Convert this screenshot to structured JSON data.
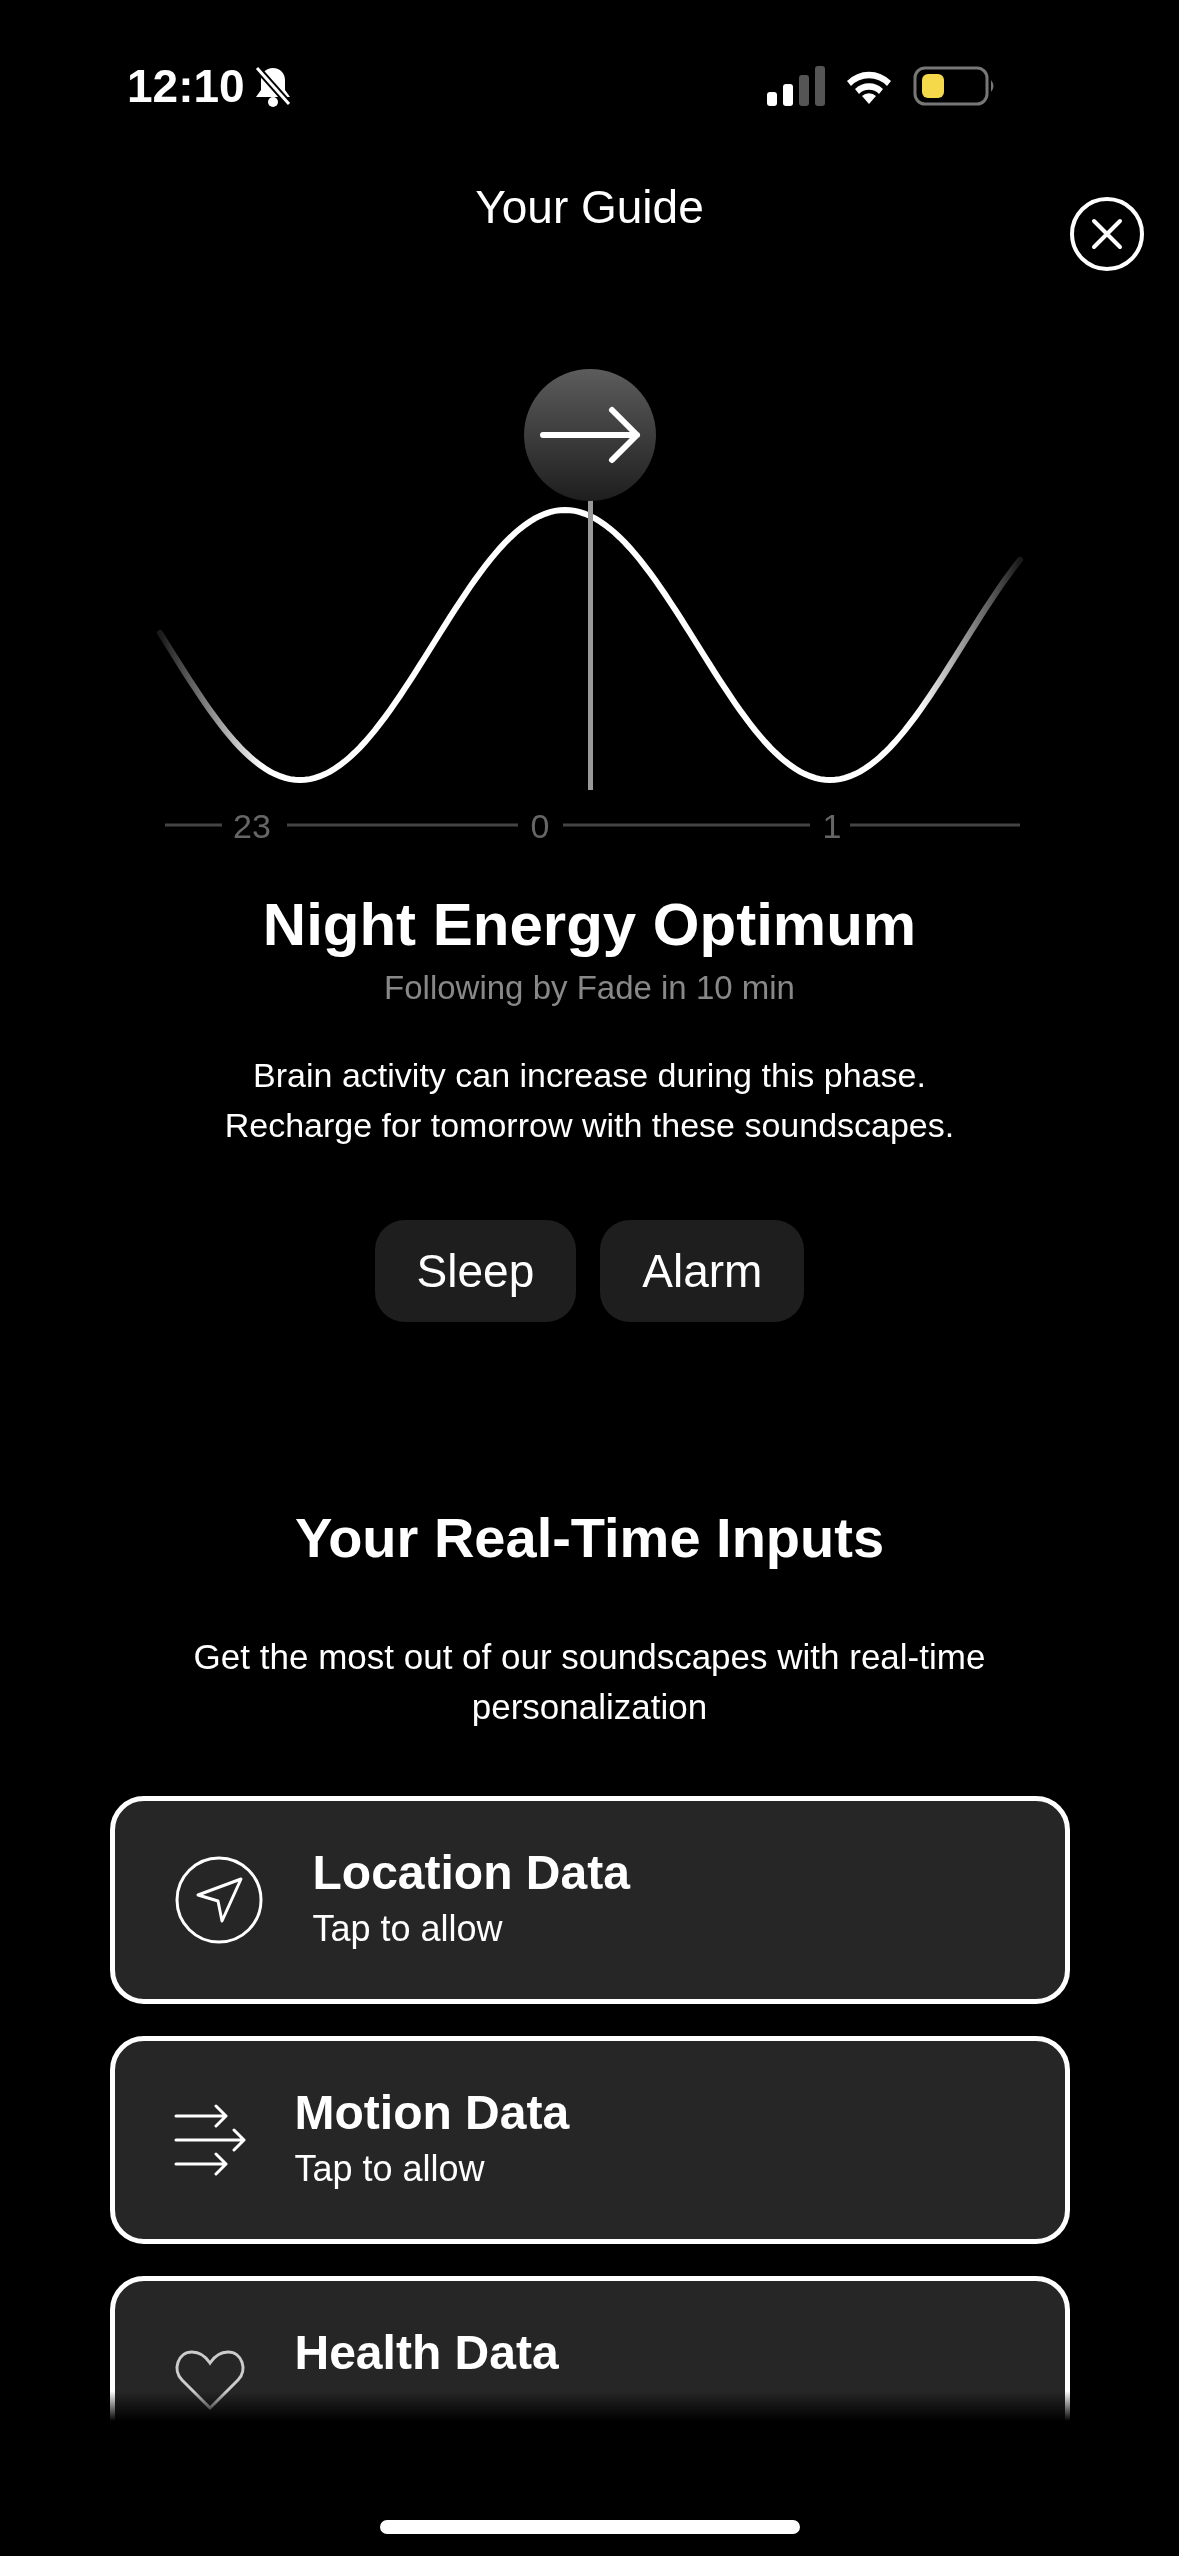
{
  "status_bar": {
    "time": "12:10"
  },
  "header": {
    "title": "Your Guide"
  },
  "timeline": {
    "labels": [
      "23",
      "0",
      "1"
    ]
  },
  "phase": {
    "title": "Night Energy Optimum",
    "next": "Following by Fade in 10 min",
    "description": "Brain activity can increase during this phase. Recharge for tomorrow with these soundscapes.",
    "buttons": [
      "Sleep",
      "Alarm"
    ]
  },
  "inputs": {
    "title": "Your Real-Time Inputs",
    "description": "Get the most out of our soundscapes with real-time personalization",
    "cards": [
      {
        "kind": "location",
        "title": "Location Data",
        "subtitle": "Tap to allow"
      },
      {
        "kind": "motion",
        "title": "Motion Data",
        "subtitle": "Tap to allow"
      },
      {
        "kind": "health",
        "title": "Health Data"
      }
    ]
  }
}
